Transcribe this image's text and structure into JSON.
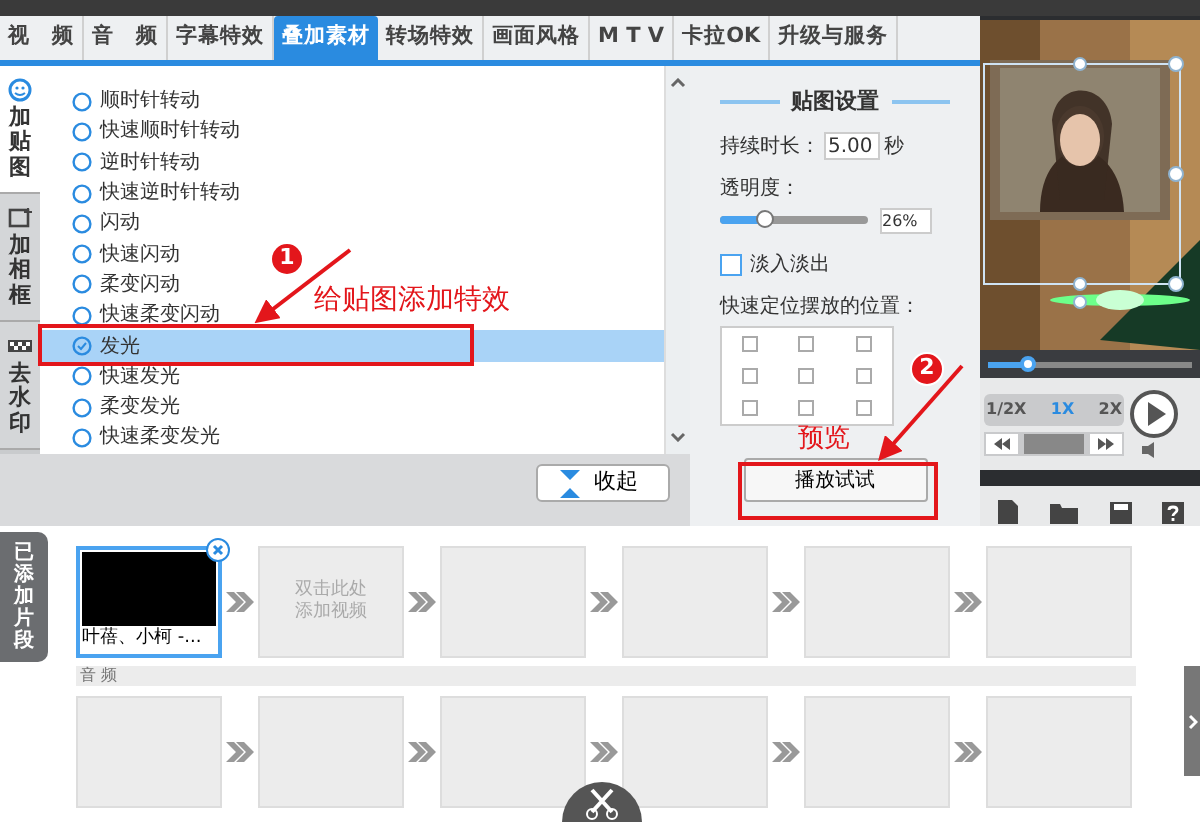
{
  "tabs": [
    {
      "label": "视　频",
      "selected": false
    },
    {
      "label": "音　频",
      "selected": false
    },
    {
      "label": "字幕特效",
      "selected": false
    },
    {
      "label": "叠加素材",
      "selected": true
    },
    {
      "label": "转场特效",
      "selected": false
    },
    {
      "label": "画面风格",
      "selected": false
    },
    {
      "label": "M T V",
      "selected": false
    },
    {
      "label": "卡拉OK",
      "selected": false
    },
    {
      "label": "升级与服务",
      "selected": false
    }
  ],
  "side_tabs": [
    {
      "label": "加贴图",
      "kind": "sticker",
      "selected": true
    },
    {
      "label": "加相框",
      "kind": "frame",
      "selected": false
    },
    {
      "label": "去水印",
      "kind": "watermark",
      "selected": false
    }
  ],
  "effects": [
    {
      "label": "顺时针转动",
      "selected": false
    },
    {
      "label": "快速顺时针转动",
      "selected": false
    },
    {
      "label": "逆时针转动",
      "selected": false
    },
    {
      "label": "快速逆时针转动",
      "selected": false
    },
    {
      "label": "闪动",
      "selected": false
    },
    {
      "label": "快速闪动",
      "selected": false
    },
    {
      "label": "柔变闪动",
      "selected": false
    },
    {
      "label": "快速柔变闪动",
      "selected": false
    },
    {
      "label": "发光",
      "selected": true
    },
    {
      "label": "快速发光",
      "selected": false
    },
    {
      "label": "柔变发光",
      "selected": false
    },
    {
      "label": "快速柔变发光",
      "selected": false
    }
  ],
  "collapse_button": "收起",
  "settings": {
    "title": "贴图设置",
    "duration_label": "持续时长：",
    "duration": "5.00",
    "duration_unit": "秒",
    "opacity_label": "透明度：",
    "opacity": {
      "level": 0.3
    },
    "opacity_value": "26%",
    "fade": {
      "label": "淡入淡出",
      "checked": false
    },
    "position_label": "快速定位摆放的位置：",
    "positions": [
      {
        "checked": false
      },
      {
        "checked": false
      },
      {
        "checked": false
      },
      {
        "checked": false
      },
      {
        "checked": false
      },
      {
        "checked": false
      },
      {
        "checked": false
      },
      {
        "checked": false
      },
      {
        "checked": false
      }
    ],
    "preview_button": "播放试试"
  },
  "preview": {
    "seek": {
      "level": 0.2
    },
    "speeds": [
      {
        "label": "1/2X",
        "selected": false
      },
      {
        "label": "1X",
        "selected": true
      },
      {
        "label": "2X",
        "selected": false
      }
    ]
  },
  "timeline": {
    "tab": "已添加片段",
    "clips": [
      {
        "kind": "clip",
        "label": "叶蓓、小柯 -..."
      },
      {
        "kind": "add",
        "label": "双击此处添加视频"
      },
      {
        "kind": "empty"
      },
      {
        "kind": "empty"
      },
      {
        "kind": "empty"
      },
      {
        "kind": "empty"
      }
    ],
    "audio_label": "音 频",
    "audio_slots": [
      {
        "kind": "empty"
      },
      {
        "kind": "empty"
      },
      {
        "kind": "empty"
      },
      {
        "kind": "empty"
      },
      {
        "kind": "empty"
      },
      {
        "kind": "empty"
      }
    ]
  },
  "annotations": [
    {
      "number": "1",
      "text": "给贴图添加特效"
    },
    {
      "number": "2",
      "text": "预览"
    }
  ]
}
